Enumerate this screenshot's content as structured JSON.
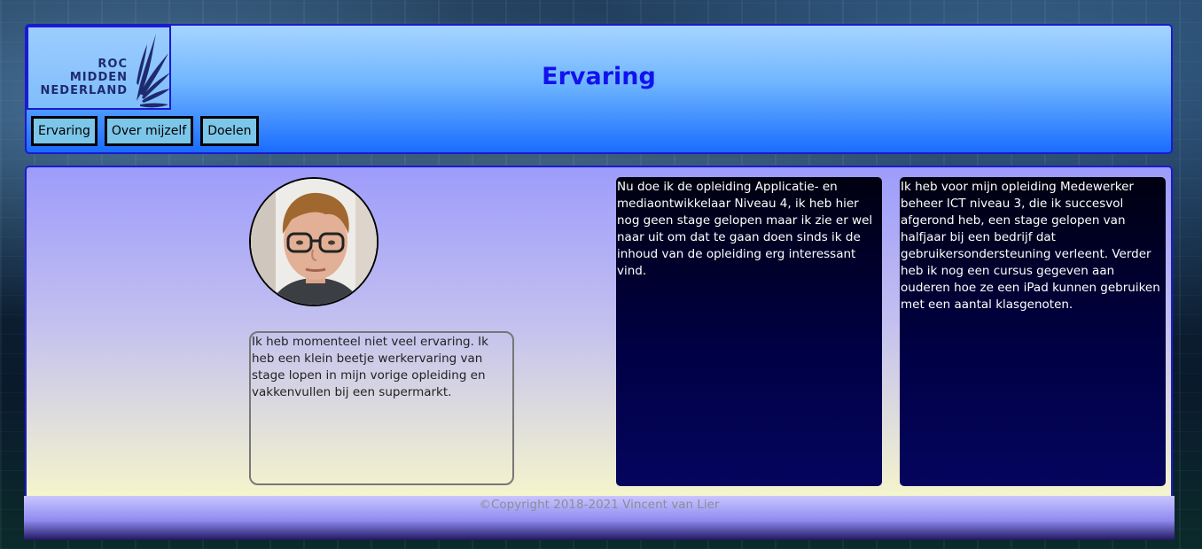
{
  "header": {
    "logo": {
      "line1": "ROC",
      "line2": "MIDDEN",
      "line3": "NEDERLAND",
      "icon": "feather-logo-icon"
    },
    "title": "Ervaring",
    "nav": [
      {
        "label": "Ervaring"
      },
      {
        "label": "Over mijzelf"
      },
      {
        "label": "Doelen"
      }
    ]
  },
  "main": {
    "avatar": "profile-photo",
    "intro_text": "Ik heb momenteel niet veel ervaring. Ik heb een klein beetje werkervaring van stage lopen in mijn vorige opleiding en vakkenvullen bij een supermarkt.",
    "current_education_text": "Nu doe ik de opleiding Applicatie- en mediaontwikkelaar Niveau 4, ik heb hier nog geen stage gelopen maar ik zie er wel naar uit om dat te gaan doen sinds ik de inhoud van de opleiding erg interessant vind.",
    "previous_education_text": "Ik heb voor mijn opleiding Medewerker beheer ICT niveau 3, die ik succesvol afgerond heb, een stage gelopen van halfjaar bij een bedrijf dat gebruikersondersteuning verleent. Verder heb ik nog een cursus gegeven aan ouderen hoe ze een iPad kunnen gebruiken met een aantal klasgenoten."
  },
  "footer": {
    "copyright": "©Copyright 2018-2021 Vincent van Lier"
  },
  "colors": {
    "title": "#1212ee",
    "border": "#1a1ad0",
    "nav_button": "#7cc6ea"
  }
}
